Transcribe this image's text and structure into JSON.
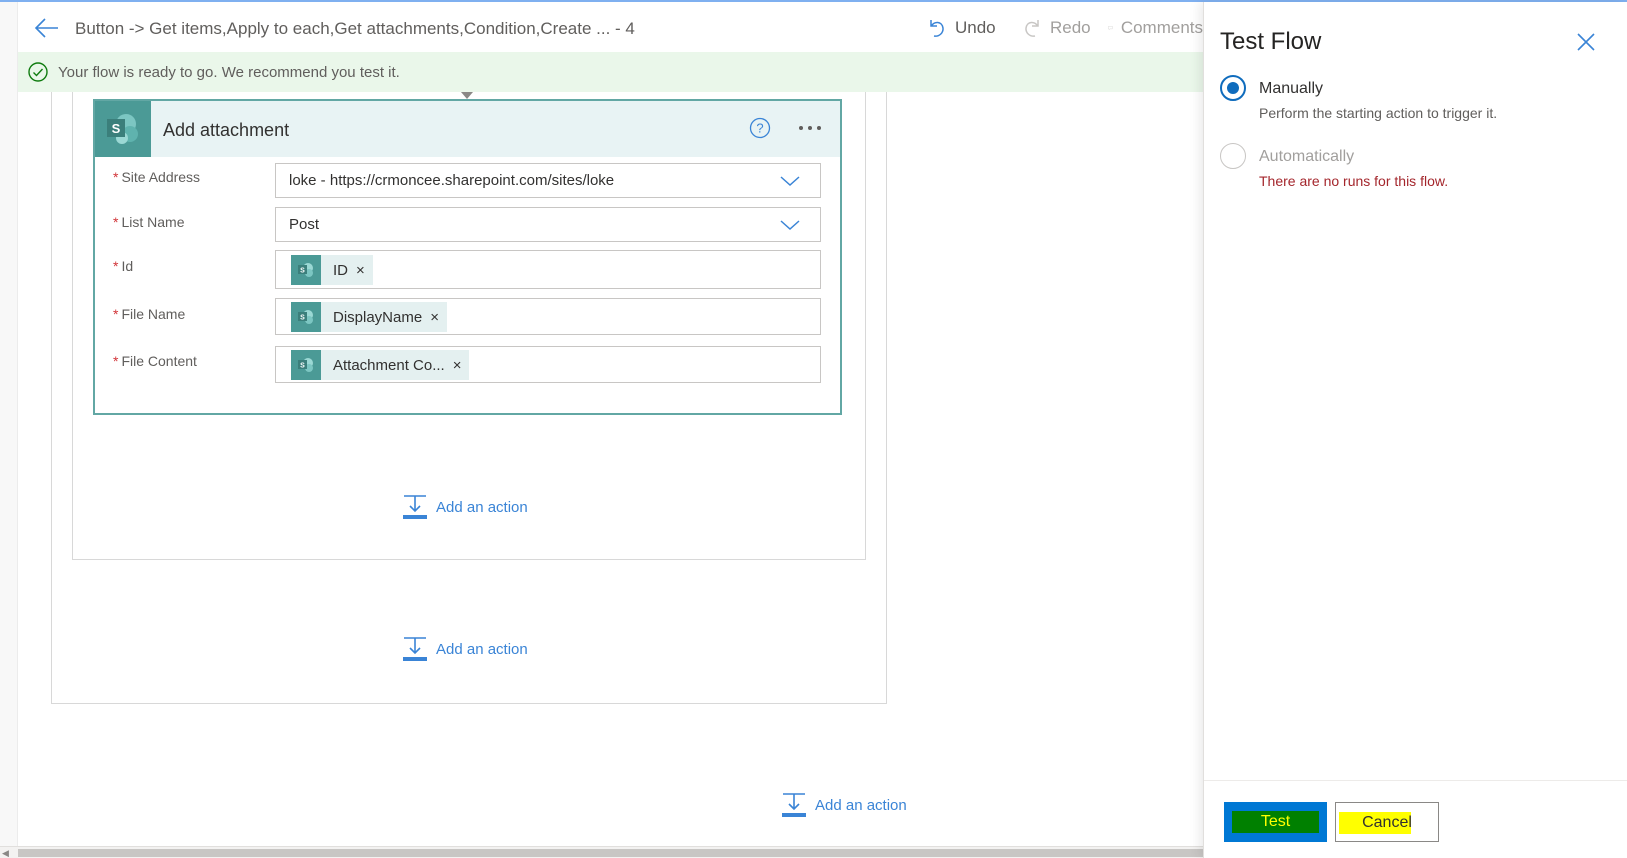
{
  "header": {
    "title": "Button -> Get items,Apply to each,Get attachments,Condition,Create ... - 4",
    "undo_label": "Undo",
    "redo_label": "Redo",
    "comments_label": "Comments"
  },
  "banner": {
    "text": "Your flow is ready to go. We recommend you test it."
  },
  "card": {
    "title": "Add attachment",
    "icon_letter": "S",
    "fields": [
      {
        "label": "Site Address",
        "required": "*",
        "value": "loke - https://crmoncee.sharepoint.com/sites/loke"
      },
      {
        "label": "List Name",
        "required": "*",
        "value": "Post"
      },
      {
        "label": "Id",
        "required": "*",
        "token": "ID"
      },
      {
        "label": "File Name",
        "required": "*",
        "token": "DisplayName"
      },
      {
        "label": "File Content",
        "required": "*",
        "token": "Attachment Co..."
      }
    ],
    "token_icon_letter": "S",
    "token_remove": "×"
  },
  "add_action": {
    "label": "Add an action"
  },
  "panel": {
    "title": "Test Flow",
    "options": [
      {
        "label": "Manually",
        "description": "Perform the starting action to trigger it.",
        "checked": true
      },
      {
        "label": "Automatically",
        "error": "There are no runs for this flow.",
        "checked": false
      }
    ],
    "test_label": "Test",
    "cancel_label": "Cancel"
  },
  "colors": {
    "accent": "#0078d4",
    "sharepoint": "#4b9a96",
    "link": "#3a84d6",
    "error": "#a4262c",
    "banner_bg": "#eaf7ea"
  }
}
